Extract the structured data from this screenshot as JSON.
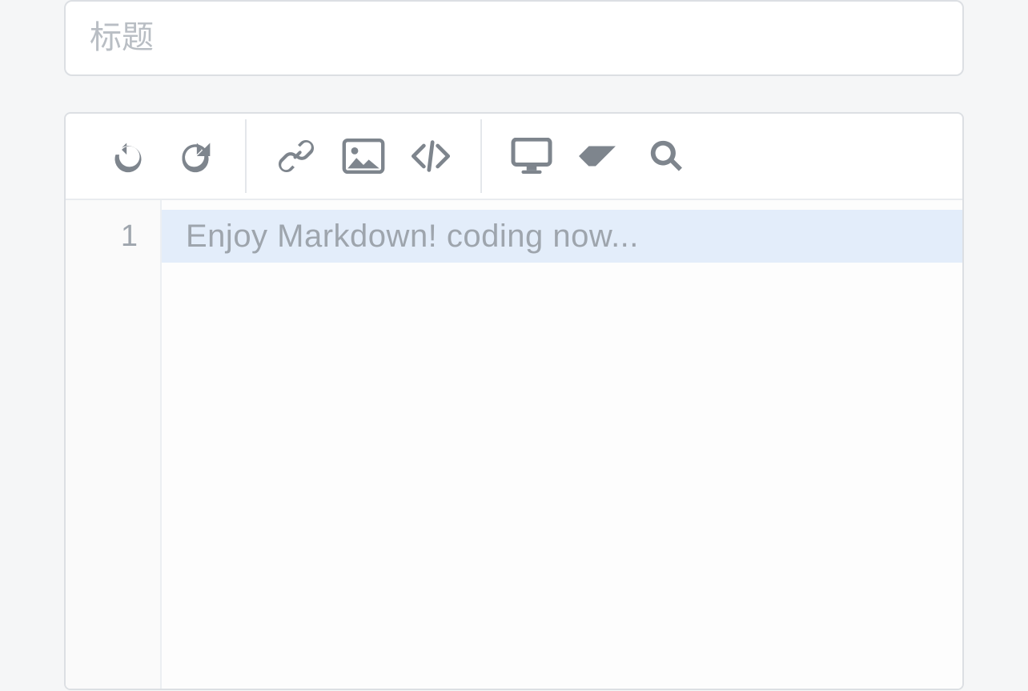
{
  "title_field": {
    "placeholder": "标题",
    "value": ""
  },
  "toolbar": {
    "undo": "undo",
    "redo": "redo",
    "link": "link",
    "image": "image",
    "code": "code",
    "preview": "preview",
    "eraser": "eraser",
    "search": "search"
  },
  "editor": {
    "line_numbers": [
      "1"
    ],
    "placeholder": "Enjoy Markdown! coding now...",
    "content": ""
  }
}
